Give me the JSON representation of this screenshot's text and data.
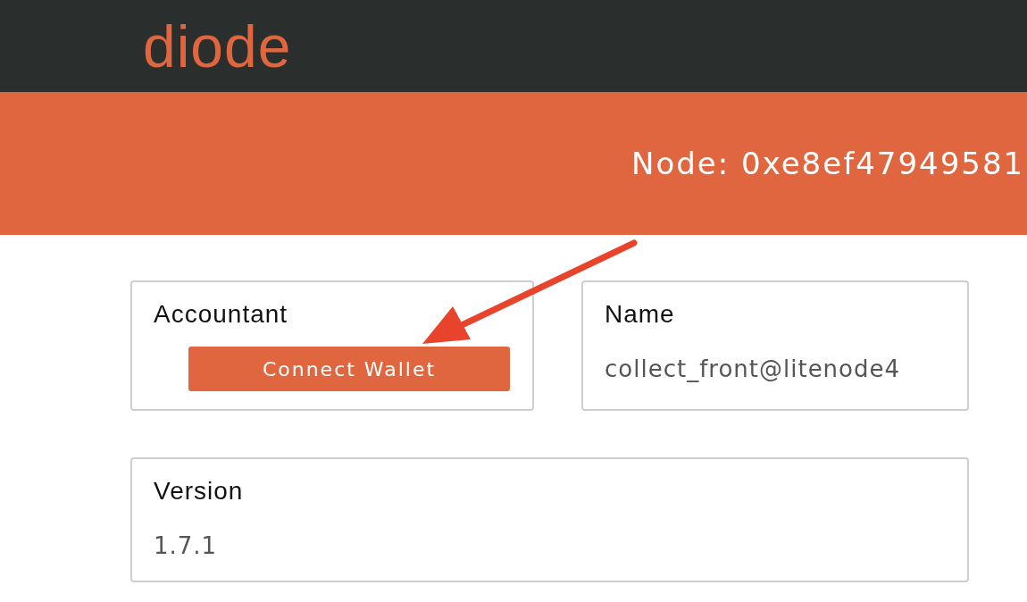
{
  "header": {
    "logo": "diode"
  },
  "banner": {
    "node": "Node: 0xe8ef47949581"
  },
  "cards": [
    {
      "kind": "button",
      "title": "Accountant",
      "button": "Connect Wallet"
    },
    {
      "kind": "value",
      "title": "Name",
      "value": "collect_front@litenode4"
    },
    {
      "kind": "value",
      "title": "Version",
      "value": "1.7.1"
    }
  ]
}
